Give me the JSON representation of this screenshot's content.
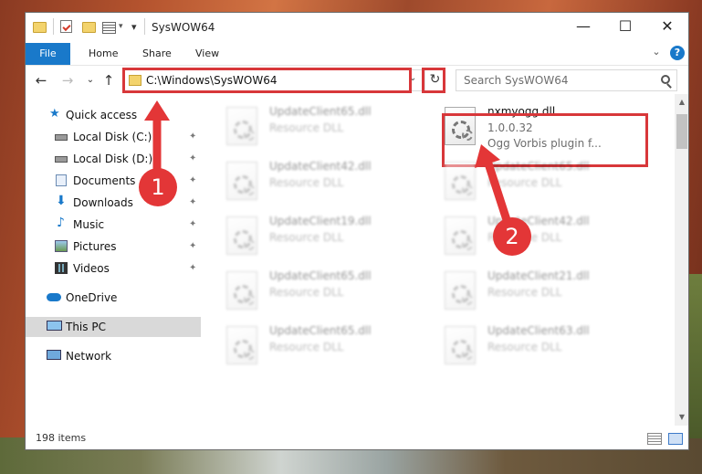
{
  "window": {
    "title": "SysWOW64",
    "minimize": "—",
    "maximize": "☐",
    "close": "✕"
  },
  "ribbon": {
    "tabs": [
      "File",
      "Home",
      "Share",
      "View"
    ],
    "expand_glyph": "⌄",
    "help_glyph": "?"
  },
  "navigation": {
    "back": "←",
    "forward": "→",
    "recent": "⌄",
    "up": "↑",
    "address": "C:\\Windows\\SysWOW64",
    "address_dropdown": "⌄",
    "refresh": "↻",
    "search_placeholder": "Search SysWOW64"
  },
  "nav_pane": {
    "items": [
      {
        "label": "Quick access",
        "icon": "star-icon"
      },
      {
        "label": "Local Disk (C:)",
        "icon": "drive-icon",
        "pinned": true
      },
      {
        "label": "Local Disk (D:)",
        "icon": "drive-icon",
        "pinned": true
      },
      {
        "label": "Documents",
        "icon": "documents-icon",
        "pinned": true
      },
      {
        "label": "Downloads",
        "icon": "download-icon",
        "pinned": true
      },
      {
        "label": "Music",
        "icon": "music-icon",
        "pinned": true
      },
      {
        "label": "Pictures",
        "icon": "pictures-icon",
        "pinned": true
      },
      {
        "label": "Videos",
        "icon": "videos-icon",
        "pinned": true
      },
      {
        "label": "OneDrive",
        "icon": "cloud-icon"
      },
      {
        "label": "This PC",
        "icon": "computer-icon",
        "selected": true
      },
      {
        "label": "Network",
        "icon": "network-icon"
      }
    ],
    "pin_glyph": "📌"
  },
  "files": {
    "left_column": [
      {
        "name": "UpdateClient65.dll",
        "type": "Resource DLL"
      },
      {
        "name": "UpdateClient42.dll",
        "type": "Resource DLL"
      },
      {
        "name": "UpdateClient19.dll",
        "type": "Resource DLL"
      },
      {
        "name": "UpdateClient65.dll",
        "type": "Resource DLL"
      },
      {
        "name": "UpdateClient65.dll",
        "type": "Resource DLL"
      }
    ],
    "right_column": [
      {
        "name": "nxmyogg.dll",
        "version": "1.0.0.32",
        "description": "Ogg Vorbis plugin f...",
        "highlighted": true
      },
      {
        "name": "UpdateClient65.dll",
        "type": "Resource DLL"
      },
      {
        "name": "UpdateClient42.dll",
        "type": "Resource DLL"
      },
      {
        "name": "UpdateClient21.dll",
        "type": "Resource DLL"
      },
      {
        "name": "UpdateClient63.dll",
        "type": "Resource DLL"
      }
    ]
  },
  "status": {
    "item_count": "198 items"
  },
  "annotations": {
    "step1": "1",
    "step2": "2",
    "color": "#e33637"
  },
  "colors": {
    "accent": "#1979ca",
    "highlight_box": "#d8373a",
    "selected_nav": "#d9d9d9"
  }
}
